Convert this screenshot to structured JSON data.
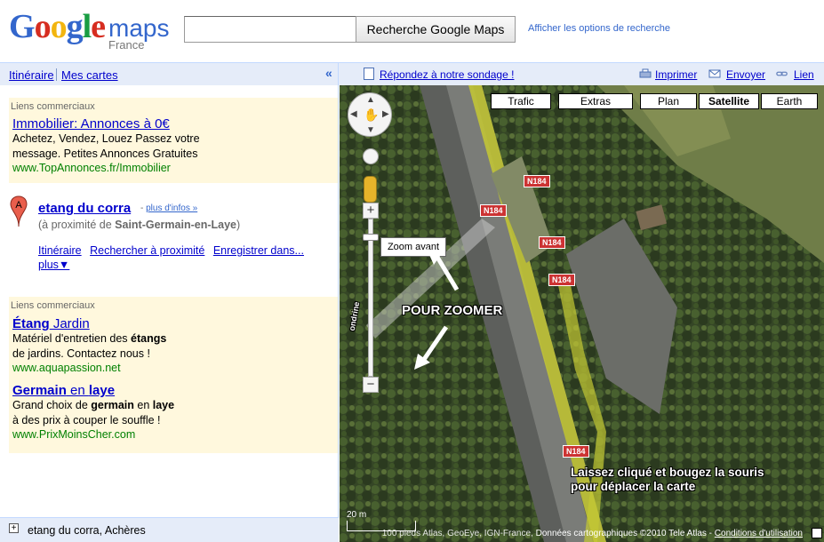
{
  "header": {
    "logo_text": "Google",
    "logo_product": "maps",
    "logo_country": "France",
    "search_value": "",
    "search_button": "Recherche Google Maps",
    "search_options": "Afficher les options de recherche"
  },
  "toolbar": {
    "itinerary": "Itinéraire",
    "my_maps": "Mes cartes",
    "collapse": "«",
    "survey": "Répondez à notre sondage !",
    "print": "Imprimer",
    "send": "Envoyer",
    "link": "Lien"
  },
  "ads_top": {
    "label": "Liens commerciaux",
    "items": [
      {
        "title": "Immobilier: Annonces à 0€",
        "body": "Achetez, Vendez, Louez Passez votre message. Petites Annonces Gratuites",
        "url": "www.TopAnnonces.fr/Immobilier"
      }
    ]
  },
  "result": {
    "marker_letter": "A",
    "title": "etang du corra",
    "more_prefix": "- ",
    "more_info": "plus d'infos »",
    "near_prefix": "(à proximité de ",
    "near_place": "Saint-Germain-en-Laye",
    "near_suffix": ")",
    "links": [
      "Itinéraire",
      "Rechercher à proximité",
      "Enregistrer dans...",
      "plus▼"
    ]
  },
  "ads_bottom": {
    "label": "Liens commerciaux",
    "items": [
      {
        "title_bold": "Étang",
        "title_rest": " Jardin",
        "body_pre": "Matériel d'entretien des ",
        "body_bold": "étangs",
        "body_post": "de jardins. Contactez nous !",
        "url": "www.aquapassion.net"
      },
      {
        "title_bold": "Germain",
        "title_mid": " en ",
        "title_bold2": "laye",
        "body_pre": "Grand choix de ",
        "body_bold": "germain",
        "body_mid": " en ",
        "body_bold2": "laye",
        "body_post": "à des prix à couper le souffle !",
        "url": "www.PrixMoinsCher.com"
      }
    ]
  },
  "bottom_bar": {
    "text": "etang du corra, Achères"
  },
  "map": {
    "types": [
      "Trafic",
      "Extras",
      "Plan",
      "Satellite",
      "Earth"
    ],
    "active_type": "Satellite",
    "zoom_in": "+",
    "zoom_out": "−",
    "zoom_level": 0.9,
    "zoom_tooltip": "Zoom avant",
    "road_label": "N184",
    "annotation_zoom": "POUR ZOOMER",
    "annotation_drag_1": "Laissez cliqué et bougez la souris",
    "annotation_drag_2": "pour déplacer la carte",
    "scale_label": "20 m",
    "copyright": "Données cartographiques ©2010 Tele Atlas - ",
    "copyright_faded": "100 pieds Atlas, GeoEye, IGN-France,",
    "terms": "Conditions d'utilisation",
    "side_label": "ondrine"
  },
  "colors": {
    "accent": "#0000cc",
    "ad_bg": "#fff8dd",
    "url_green": "#008000",
    "toolbar_bg": "#e5ecf9"
  }
}
